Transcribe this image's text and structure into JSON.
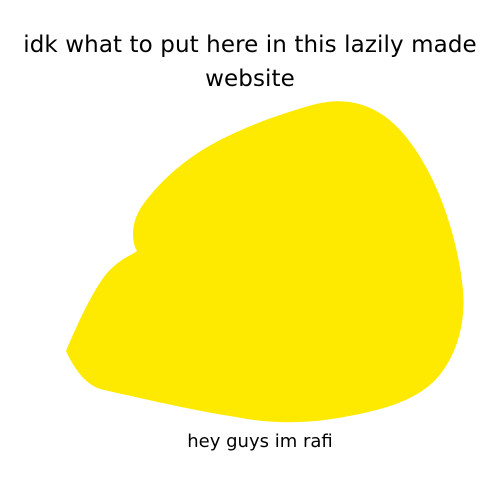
{
  "header": {
    "title_line1": "idk what to put here in this lazily made",
    "title_line2": "website"
  },
  "blob": {
    "icon": "yellow-blob-shape",
    "fill_color": "#FEEA00"
  },
  "footer": {
    "caption": "hey guys im rafi"
  }
}
